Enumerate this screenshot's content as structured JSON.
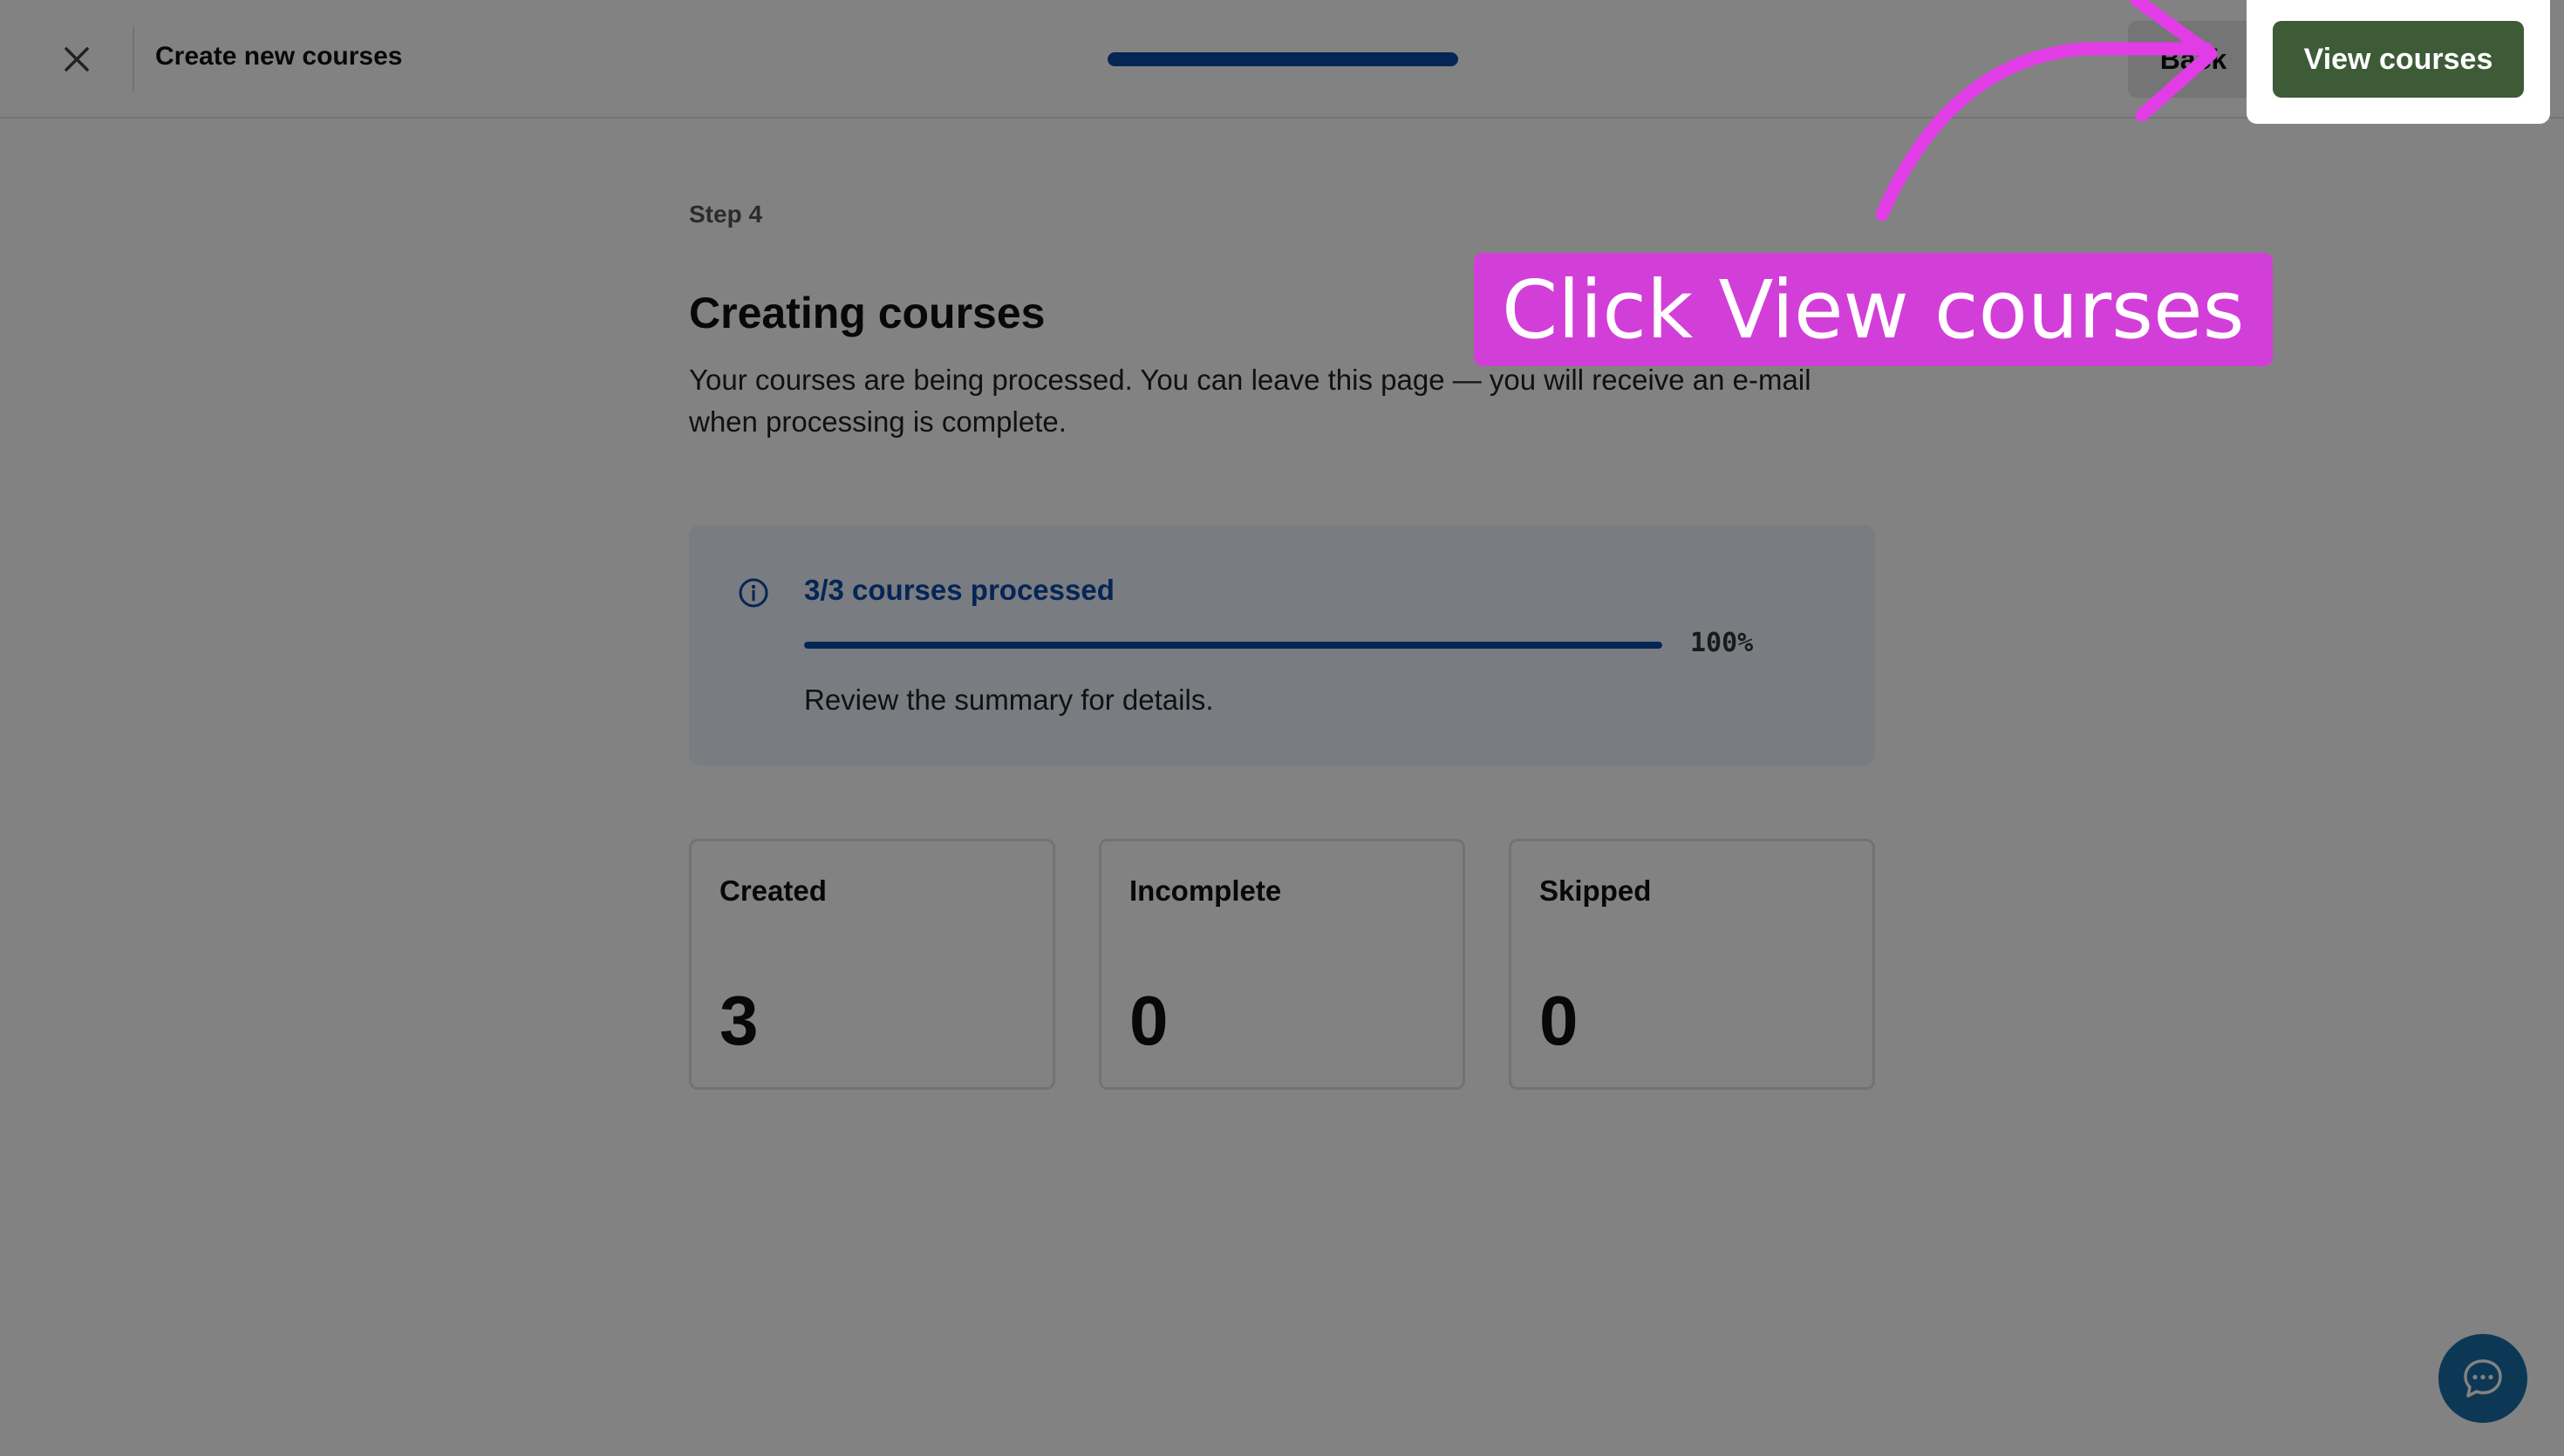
{
  "header": {
    "close_icon": "close-icon",
    "title": "Create new courses",
    "wizard_progress": 1.0,
    "back_label": "Back",
    "view_courses_label": "View courses"
  },
  "main": {
    "step_label": "Step 4",
    "title": "Creating courses",
    "description": "Your courses are being processed. You can leave this page — you will receive an e-mail when processing is complete.",
    "info": {
      "icon": "info-icon",
      "title": "3/3 courses processed",
      "progress_percent": 100,
      "progress_text": "100%",
      "subtitle": "Review the summary for details."
    },
    "summary": [
      {
        "label": "Created",
        "value": "3"
      },
      {
        "label": "Incomplete",
        "value": "0"
      },
      {
        "label": "Skipped",
        "value": "0"
      }
    ]
  },
  "guide": {
    "callout_text": "Click View courses",
    "callout_color": "#d23fd8"
  },
  "chat": {
    "icon": "chat-bubble-icon"
  },
  "colors": {
    "accent_blue": "#0b4aa8",
    "primary_button": "#3e5b38"
  }
}
